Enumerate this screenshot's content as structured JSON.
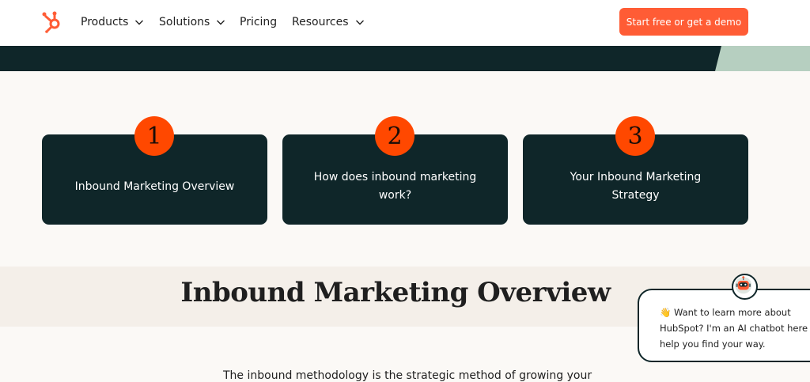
{
  "header": {
    "logo_icon": "hubspot-sprocket-icon",
    "nav": [
      {
        "label": "Products",
        "has_dropdown": true
      },
      {
        "label": "Solutions",
        "has_dropdown": true
      },
      {
        "label": "Pricing",
        "has_dropdown": false
      },
      {
        "label": "Resources",
        "has_dropdown": true
      }
    ],
    "cta_label": "Start free or get a demo"
  },
  "steps": [
    {
      "number": "1",
      "label": "Inbound Marketing Overview"
    },
    {
      "number": "2",
      "label": "How does inbound marketing work?"
    },
    {
      "number": "3",
      "label": "Your Inbound Marketing Strategy"
    }
  ],
  "section": {
    "title": "Inbound Marketing Overview",
    "body_start": "The inbound methodology is the strategic method of growing your"
  },
  "chatbot": {
    "avatar_icon": "robot-icon",
    "lines": [
      "👋 Want to learn more about",
      "HubSpot? I'm an AI chatbot here t",
      "help you find your way."
    ]
  },
  "colors": {
    "accent": "#ff5c35",
    "badge": "#ff4800",
    "dark": "#0f2629",
    "band_accent": "#b6cfc0",
    "page_bg": "#fbf9f6"
  }
}
